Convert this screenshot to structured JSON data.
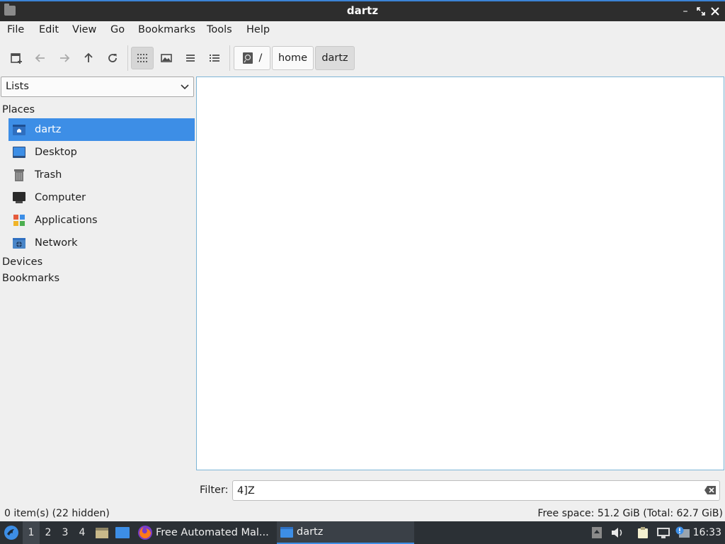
{
  "window": {
    "title": "dartz"
  },
  "menubar": {
    "items": [
      "File",
      "Edit",
      "View",
      "Go",
      "Bookmarks",
      "Tools",
      "Help"
    ]
  },
  "breadcrumb": [
    {
      "label": "/",
      "icon": "drive-icon"
    },
    {
      "label": "home"
    },
    {
      "label": "dartz",
      "active": true
    }
  ],
  "side_pane": {
    "mode": "Lists",
    "sections": {
      "places": "Places",
      "devices": "Devices",
      "bookmarks": "Bookmarks"
    },
    "places": [
      {
        "label": "dartz",
        "icon": "home-folder-icon",
        "selected": true
      },
      {
        "label": "Desktop",
        "icon": "desktop-icon"
      },
      {
        "label": "Trash",
        "icon": "trash-icon"
      },
      {
        "label": "Computer",
        "icon": "computer-icon"
      },
      {
        "label": "Applications",
        "icon": "applications-icon"
      },
      {
        "label": "Network",
        "icon": "network-icon"
      }
    ]
  },
  "filter": {
    "label": "Filter:",
    "value": "4]Z"
  },
  "status": {
    "items": "0 item(s) (22 hidden)",
    "free_space": "Free space: 51.2 GiB (Total: 62.7 GiB)"
  },
  "taskbar": {
    "workspaces": [
      "1",
      "2",
      "3",
      "4"
    ],
    "active_workspace": "1",
    "tasks": [
      {
        "label": "Free Automated Mal...",
        "icon": "firefox-icon"
      },
      {
        "label": "dartz",
        "icon": "folder-icon",
        "active": true
      }
    ],
    "clock": "16:33"
  },
  "colors": {
    "accent": "#3d8ee6",
    "titlebar": "#2d2d2d",
    "taskbar": "#2b3035",
    "view_border": "#7db5d6"
  }
}
